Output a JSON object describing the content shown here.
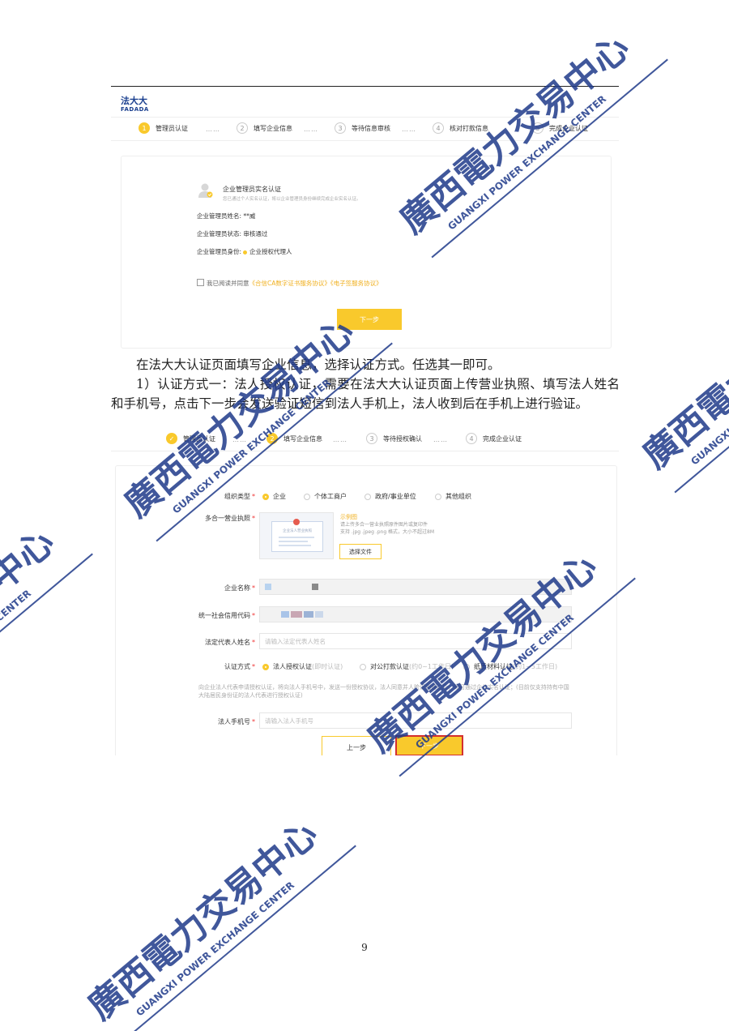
{
  "screenshot1": {
    "logo_cn": "法大大",
    "logo_en": "FADADA",
    "steps": [
      {
        "num": "1",
        "label": "管理员认证"
      },
      {
        "num": "2",
        "label": "填写企业信息"
      },
      {
        "num": "3",
        "label": "等待信息审核"
      },
      {
        "num": "4",
        "label": "核对打款信息"
      },
      {
        "num": "5",
        "label": "完成企业认证"
      }
    ],
    "dots": "……",
    "card_title": "企业管理员实名认证",
    "card_sub": "您已通过个人实名认证，将以企业管理员身份继续完成企业实名认证。",
    "admin_name_label": "企业管理员姓名:",
    "admin_name_value": "**威",
    "admin_status_label": "企业管理员状态:",
    "admin_status_value": "审核通过",
    "admin_identity_label": "企业管理员身份:",
    "admin_identity_value": "企业授权代理人",
    "agree_prefix": "我已阅读并同意",
    "agree_link": "《合信CA数字证书服务协议》《电子签服务协议》",
    "next_button": "下一步"
  },
  "para1": "在法大大认证页面填写企业信息，选择认证方式。任选其一即可。",
  "para2": "1）认证方式一：法人授权认证，需要在法大大认证页面上传营业执照、填写法人姓名和手机号，点击下一步会发送验证短信到法人手机上，法人收到后在手机上进行验证。",
  "screenshot2": {
    "steps": [
      {
        "num": "✓",
        "label": "管理员认证"
      },
      {
        "num": "2",
        "label": "填写企业信息"
      },
      {
        "num": "3",
        "label": "等待授权确认"
      },
      {
        "num": "4",
        "label": "完成企业认证"
      }
    ],
    "dots": "……",
    "org_type_label": "组织类型",
    "org_types": [
      "企业",
      "个体工商户",
      "政府/事业单位",
      "其他组织"
    ],
    "license_label": "多合一营业执照",
    "sample_label": "示例图",
    "upload_tip_1": "请上传多合一营业执照原件图片或复印件",
    "upload_tip_2": "支持 .jpg .jpeg .png 格式，大小不超过8M",
    "sample_caption": "企业法人营业执照",
    "choose_file": "选择文件",
    "company_name_label": "企业名称",
    "credit_code_label": "统一社会信用代码",
    "legal_name_label": "法定代表人姓名",
    "legal_name_placeholder": "请输入法定代表人姓名",
    "auth_method_label": "认证方式",
    "auth_methods": [
      {
        "label": "法人授权认证",
        "hint": "(即时认证)"
      },
      {
        "label": "对公打款认证",
        "hint": "(约0~1工作日)"
      },
      {
        "label": "纸质材料认证",
        "hint": "(约1~5工作日)"
      }
    ],
    "auth_note": "向企业法人代表申请授权认证，将向法人手机号中，发送一份授权协议，法人同意并人脸识别通过后，即可通过企业实名认证；(目前仅支持持有中国大陆居民身份证的法人代表进行授权认证)",
    "legal_phone_label": "法人手机号",
    "legal_phone_placeholder": "请输入法人手机号",
    "prev_button": "上一步",
    "next_button": "下一步",
    "required_mark": "*"
  },
  "watermark": {
    "cn": "廣西電力交易中心",
    "en": "GUANGXI POWER EXCHANGE CENTER",
    "color": "#1f3a8a"
  },
  "page_number": "9"
}
